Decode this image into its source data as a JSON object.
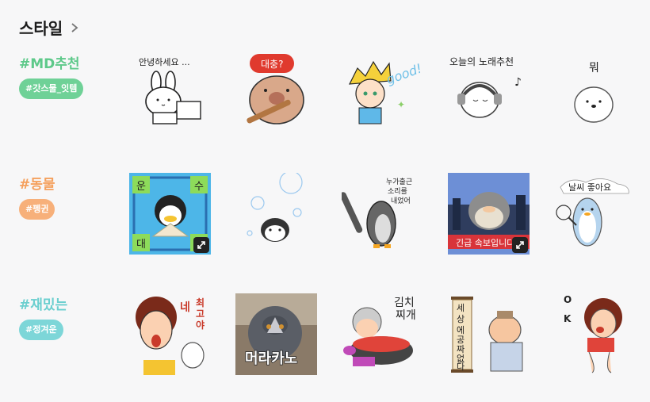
{
  "section": {
    "title": "스타일",
    "icons": {
      "more": "chevron-right-icon",
      "expand": "expand-icon"
    }
  },
  "rows": [
    {
      "hashtag": "#MD추천",
      "tag": "#갓스물_잇템",
      "hashtag_color": "#5ec98a",
      "tag_color": "#6fd197",
      "stickers": [
        {
          "name": "rabbit-hello",
          "caption": "안녕하세요 ..."
        },
        {
          "name": "bear-bat",
          "caption": "대충?"
        },
        {
          "name": "boy-good",
          "caption": "good!"
        },
        {
          "name": "headphone-bear",
          "caption": "오늘의 노래추천"
        },
        {
          "name": "white-bear-what",
          "caption": "뭐"
        }
      ]
    },
    {
      "hashtag": "#동물",
      "tag": "#펭귄",
      "hashtag_color": "#f5a05d",
      "tag_color": "#f7b07a",
      "stickers": [
        {
          "name": "penguin-fan",
          "caption": "운 수 대 통"
        },
        {
          "name": "penguin-bubbles",
          "caption": ""
        },
        {
          "name": "penguin-bat",
          "caption": "누가출근 소리를 내었어"
        },
        {
          "name": "penguin-news",
          "caption": "긴급 속보입니다"
        },
        {
          "name": "penguin-weather",
          "caption": "날씨 좋아요"
        }
      ]
    },
    {
      "hashtag": "#재밌는",
      "tag": "#정겨운",
      "hashtag_color": "#6bcfcf",
      "tag_color": "#7dd6d8",
      "stickers": [
        {
          "name": "mom-yes",
          "caption": "네 최고야"
        },
        {
          "name": "pigeon-photo",
          "caption": "머라카노"
        },
        {
          "name": "grandma-kimchi",
          "caption": "김치 찌개"
        },
        {
          "name": "scroll-elder",
          "caption": "세상에 공짜없다"
        },
        {
          "name": "lady-ok",
          "caption": "OK"
        }
      ]
    }
  ]
}
